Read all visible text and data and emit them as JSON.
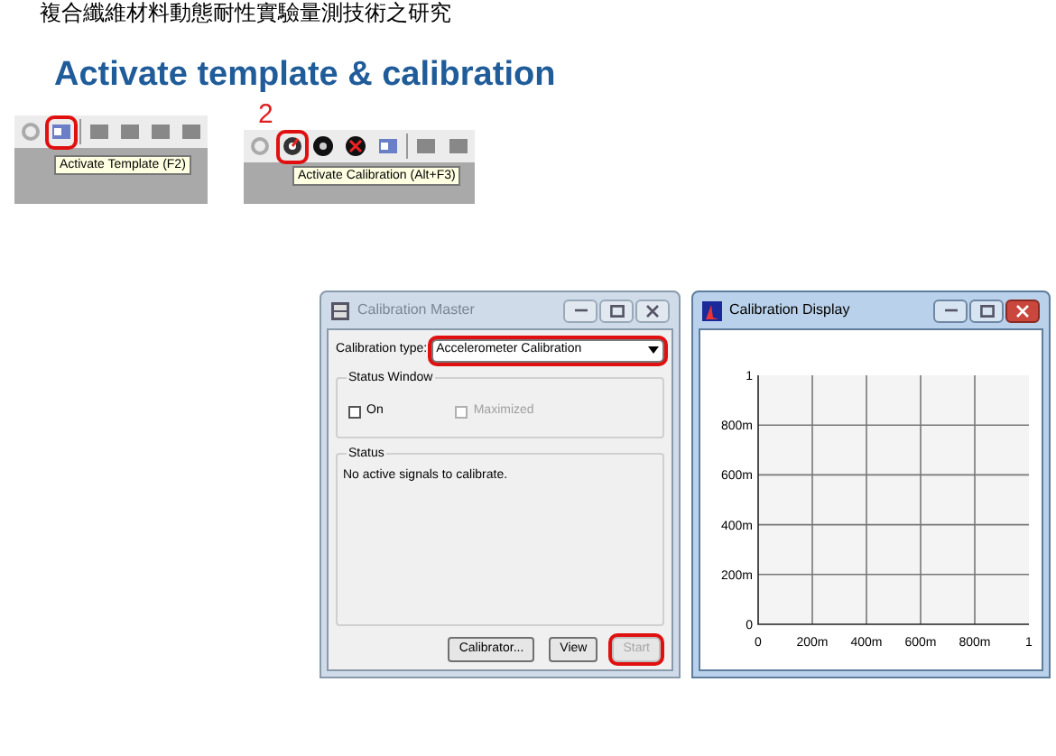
{
  "header_text": "複合纖維材料動態耐性實驗量測技術之研究",
  "title": "Activate template & calibration",
  "toolbar_snippets": [
    {
      "tooltip": "Activate Template (F2)",
      "tools": [
        {
          "kind": "gear",
          "highlighted": false
        },
        {
          "kind": "template",
          "highlighted": true
        },
        {
          "kind": "separator",
          "highlighted": false
        },
        {
          "kind": "block",
          "highlighted": false
        },
        {
          "kind": "block",
          "highlighted": false
        },
        {
          "kind": "block",
          "highlighted": false
        },
        {
          "kind": "block",
          "highlighted": false
        }
      ]
    },
    {
      "step_number": "2",
      "tooltip": "Activate Calibration (Alt+F3)",
      "tools": [
        {
          "kind": "gear",
          "highlighted": false
        },
        {
          "kind": "gauge",
          "highlighted": true
        },
        {
          "kind": "disc",
          "highlighted": false
        },
        {
          "kind": "stop",
          "highlighted": false
        },
        {
          "kind": "template",
          "highlighted": false
        },
        {
          "kind": "separator",
          "highlighted": false
        },
        {
          "kind": "block",
          "highlighted": false
        },
        {
          "kind": "block",
          "highlighted": false
        }
      ]
    }
  ],
  "calibration_master": {
    "title": "Calibration Master",
    "active": false,
    "type_label": "Calibration type:",
    "type_value": "Accelerometer Calibration",
    "type_highlighted": true,
    "status_window": {
      "label": "Status Window",
      "options": [
        {
          "label": "On",
          "checked": false,
          "disabled": false
        },
        {
          "label": "Maximized",
          "checked": false,
          "disabled": true
        }
      ]
    },
    "status": {
      "label": "Status",
      "message": "No active signals to calibrate."
    },
    "buttons": [
      {
        "label": "Calibrator...",
        "disabled": false,
        "highlighted": false
      },
      {
        "label": "View",
        "disabled": false,
        "highlighted": false
      },
      {
        "label": "Start",
        "disabled": true,
        "highlighted": true
      }
    ]
  },
  "calibration_display": {
    "title": "Calibration Display",
    "active": true,
    "plot": {
      "x_axis_labels": [
        "0",
        "200m",
        "400m",
        "600m",
        "800m",
        "1"
      ],
      "y_axis_labels": [
        "1",
        "800m",
        "600m",
        "400m",
        "200m",
        "0"
      ]
    }
  }
}
